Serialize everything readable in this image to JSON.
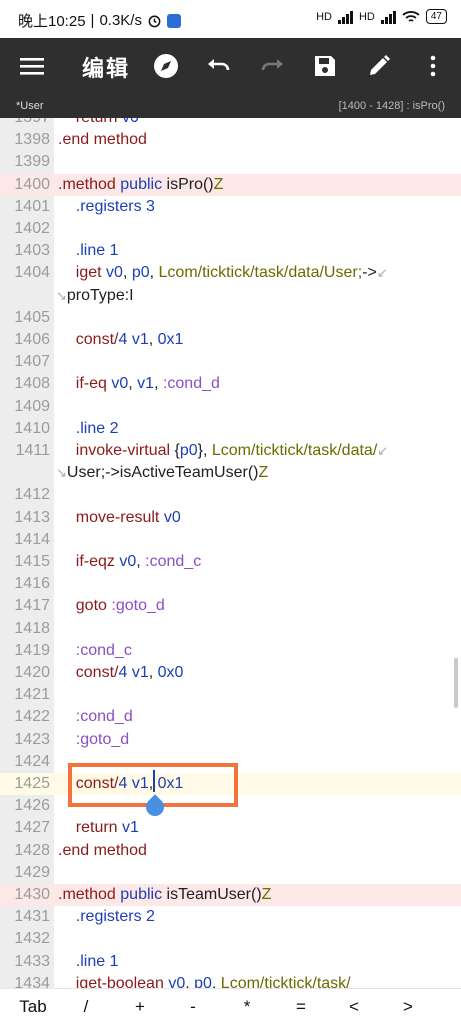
{
  "status": {
    "time": "晚上10:25",
    "speed": "0.3K/s",
    "sim1": "HD",
    "sim2": "HD",
    "battery": "47"
  },
  "appbar": {
    "title": "编辑",
    "icons": [
      "menu-icon",
      "compass-icon",
      "undo-icon",
      "redo-icon",
      "save-icon",
      "pencil-icon",
      "more-icon"
    ]
  },
  "subbar": {
    "file": "*User",
    "range": "[1400 - 1428] : isPro()"
  },
  "lines": [
    {
      "n": "1397",
      "t": "    return v0",
      "partial": true
    },
    {
      "n": "1398",
      "t": ".end method"
    },
    {
      "n": "1399",
      "t": ""
    },
    {
      "n": "1400",
      "t": ".method public isPro()Z"
    },
    {
      "n": "1401",
      "t": "    .registers 3"
    },
    {
      "n": "1402",
      "t": ""
    },
    {
      "n": "1403",
      "t": "    .line 1"
    },
    {
      "n": "1404",
      "t": "    iget v0, p0, Lcom/ticktick/task/data/User;->"
    },
    {
      "n": "",
      "t": "proType:I"
    },
    {
      "n": "1405",
      "t": ""
    },
    {
      "n": "1406",
      "t": "    const/4 v1, 0x1"
    },
    {
      "n": "1407",
      "t": ""
    },
    {
      "n": "1408",
      "t": "    if-eq v0, v1, :cond_d"
    },
    {
      "n": "1409",
      "t": ""
    },
    {
      "n": "1410",
      "t": "    .line 2"
    },
    {
      "n": "1411",
      "t": "    invoke-virtual {p0}, Lcom/ticktick/task/data/"
    },
    {
      "n": "",
      "t": "User;->isActiveTeamUser()Z"
    },
    {
      "n": "1412",
      "t": ""
    },
    {
      "n": "1413",
      "t": "    move-result v0"
    },
    {
      "n": "1414",
      "t": ""
    },
    {
      "n": "1415",
      "t": "    if-eqz v0, :cond_c"
    },
    {
      "n": "1416",
      "t": ""
    },
    {
      "n": "1417",
      "t": "    goto :goto_d"
    },
    {
      "n": "1418",
      "t": ""
    },
    {
      "n": "1419",
      "t": "    :cond_c"
    },
    {
      "n": "1420",
      "t": "    const/4 v1, 0x0"
    },
    {
      "n": "1421",
      "t": ""
    },
    {
      "n": "1422",
      "t": "    :cond_d"
    },
    {
      "n": "1423",
      "t": "    :goto_d"
    },
    {
      "n": "1424",
      "t": ""
    },
    {
      "n": "1425",
      "t": "    const/4 v1, 0x1"
    },
    {
      "n": "1426",
      "t": ""
    },
    {
      "n": "1427",
      "t": "    return v1"
    },
    {
      "n": "1428",
      "t": ".end method"
    },
    {
      "n": "1429",
      "t": ""
    },
    {
      "n": "1430",
      "t": ".method public isTeamUser()Z"
    },
    {
      "n": "1431",
      "t": "    .registers 2"
    },
    {
      "n": "1432",
      "t": ""
    },
    {
      "n": "1433",
      "t": "    .line 1"
    },
    {
      "n": "1434",
      "t": "    iget-boolean v0, p0, Lcom/ticktick/task/"
    }
  ],
  "keys": [
    "Tab",
    "/",
    "+",
    "-",
    "*",
    "=",
    "<",
    ">"
  ],
  "colors": {
    "toolbar": "#2f2f2f",
    "highlight": "#f0743c",
    "method_bg": "#fde8e8",
    "current_line_bg": "#fffbe6"
  }
}
